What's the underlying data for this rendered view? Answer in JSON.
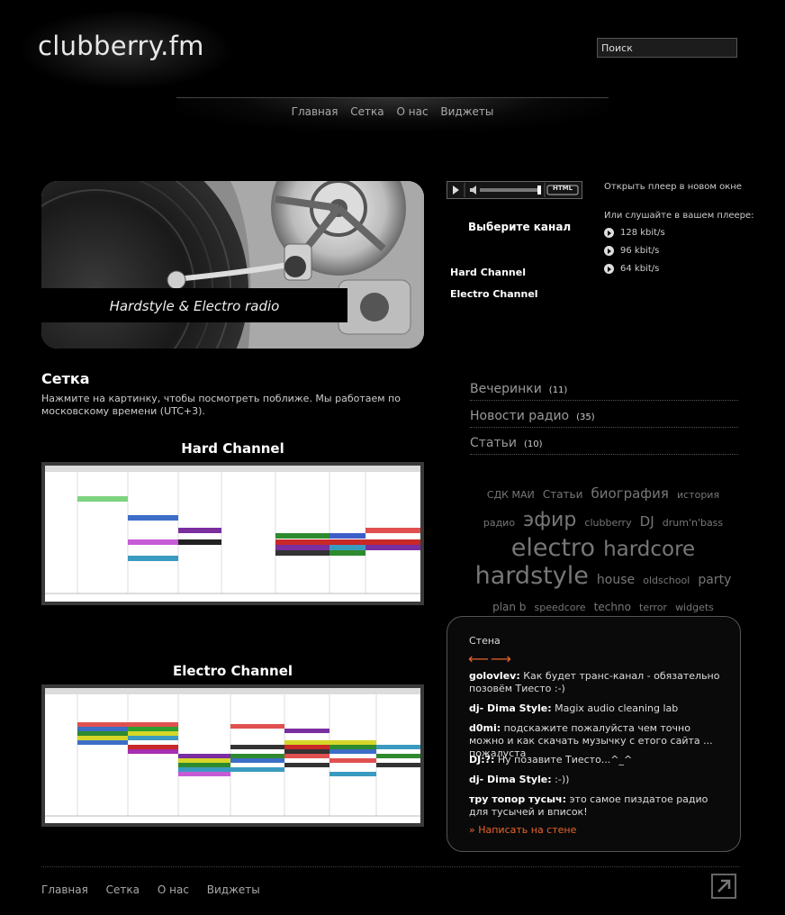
{
  "header": {
    "logo": "clubberry.fm",
    "search_placeholder": "Поиск",
    "nav": [
      "Главная",
      "Сетка",
      "О нас",
      "Виджеты"
    ]
  },
  "hero": {
    "caption": "Hardstyle & Electro radio"
  },
  "player": {
    "html_label": "HTML",
    "open_new_window": "Открыть плеер в новом окне",
    "choose_channel": "Выберите канал",
    "channels": [
      "Hard Channel",
      "Electro Channel"
    ],
    "listen_in_player": "Или слушайте в вашем плеере:",
    "bitrates": [
      "128 kbit/s",
      "96 kbit/s",
      "64 kbit/s"
    ]
  },
  "schedule": {
    "title": "Сетка",
    "description": "Нажмите на картинку, чтобы посмотреть поближе. Мы работаем по московскому времени (UTC+3).",
    "hard_title": "Hard Channel",
    "electro_title": "Electro Channel"
  },
  "categories": [
    {
      "label": "Вечеринки",
      "count": "(11)"
    },
    {
      "label": "Новости радио",
      "count": "(35)"
    },
    {
      "label": "Статьи",
      "count": "(10)"
    }
  ],
  "tags": [
    {
      "label": "СДК МАИ",
      "size": 11
    },
    {
      "label": "Статьи",
      "size": 12
    },
    {
      "label": "биография",
      "size": 15
    },
    {
      "label": "история",
      "size": 11
    },
    {
      "label": "радио",
      "size": 11
    },
    {
      "label": "эфир",
      "size": 22
    },
    {
      "label": "clubberry",
      "size": 11
    },
    {
      "label": "DJ",
      "size": 15
    },
    {
      "label": "drum'n'bass",
      "size": 11
    },
    {
      "label": "electro",
      "size": 27
    },
    {
      "label": "hardcore",
      "size": 23
    },
    {
      "label": "hardstyle",
      "size": 27
    },
    {
      "label": "house",
      "size": 14
    },
    {
      "label": "oldschool",
      "size": 11
    },
    {
      "label": "party",
      "size": 14
    },
    {
      "label": "plan b",
      "size": 12
    },
    {
      "label": "speedcore",
      "size": 11
    },
    {
      "label": "techno",
      "size": 12
    },
    {
      "label": "terror",
      "size": 11
    },
    {
      "label": "widgets",
      "size": 11
    }
  ],
  "wall": {
    "title": "Стена",
    "arrows": "⟵⟶",
    "posts": [
      {
        "user": "golovlev:",
        "text": " Как будет транс-канал - обязательно позовём Тиесто :-)"
      },
      {
        "user": "dj- Dima Style:",
        "text": " Magix audio cleaning lab"
      },
      {
        "user": "d0mi:",
        "text": " подскажите пожалуйста чем точно можно и как скачать музычку с етого сайта ... пожалуста"
      },
      {
        "user": "DJ:?:",
        "text": " Ну позавите Тиесто...^_^"
      },
      {
        "user": "dj- Dima Style:",
        "text": " :-))"
      },
      {
        "user": "тру топор тусыч:",
        "text": " это самое пиздатое радио для тусычей и вписок!"
      }
    ],
    "write_link": "» Написать на стене"
  },
  "footer": {
    "nav": [
      "Главная",
      "Сетка",
      "О нас",
      "Виджеты"
    ]
  },
  "colors": {
    "accent": "#e8642c",
    "background": "#000000"
  }
}
